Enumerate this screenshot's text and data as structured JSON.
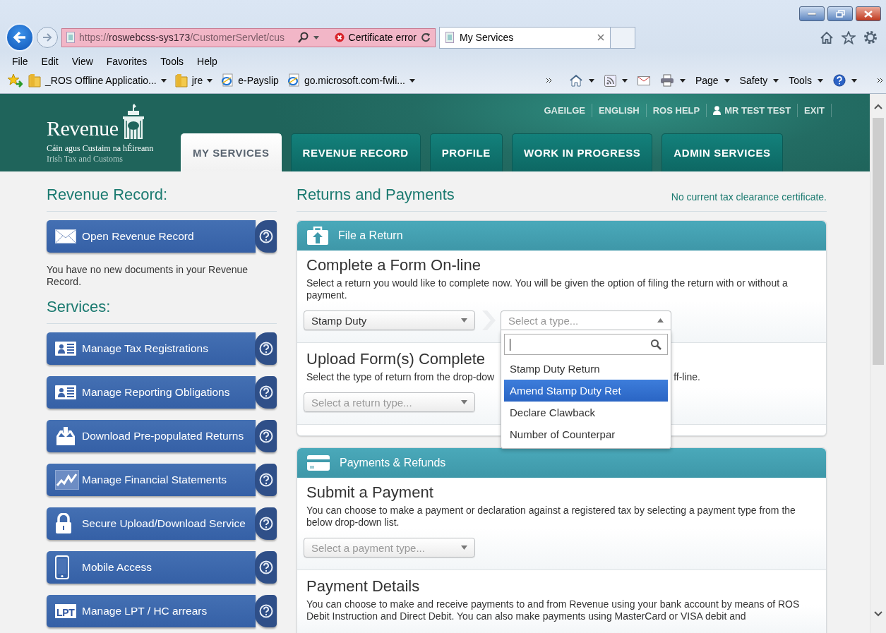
{
  "browser": {
    "address": {
      "scheme": "https://",
      "host": "roswebcss-sys173",
      "path": "/CustomerServlet/cus"
    },
    "certificate_error": "Certificate error",
    "tabs": [
      {
        "title": "My Services",
        "selected": true
      }
    ],
    "menu": [
      "File",
      "Edit",
      "View",
      "Favorites",
      "Tools",
      "Help"
    ],
    "favorites": [
      {
        "kind": "folder",
        "label": "_ROS Offline Applicatio...",
        "dropdown": true
      },
      {
        "kind": "folder",
        "label": "jre",
        "dropdown": true
      },
      {
        "kind": "page",
        "label": "e-Payslip",
        "dropdown": false
      },
      {
        "kind": "page",
        "label": "go.microsoft.com-fwli...",
        "dropdown": true
      }
    ],
    "commands": [
      {
        "kind": "home",
        "dropdown": true
      },
      {
        "kind": "feed",
        "dropdown": true
      },
      {
        "kind": "mail",
        "dropdown": false
      },
      {
        "kind": "print",
        "dropdown": true
      },
      {
        "kind": "text",
        "label": "Page",
        "dropdown": true
      },
      {
        "kind": "text",
        "label": "Safety",
        "dropdown": true
      },
      {
        "kind": "text",
        "label": "Tools",
        "dropdown": true
      },
      {
        "kind": "help",
        "dropdown": true
      }
    ]
  },
  "header": {
    "logo": {
      "name": "Revenue",
      "irish": "Cáin agus Custaim na hÉireann",
      "english": "Irish Tax and Customs"
    },
    "links": [
      {
        "kind": "link",
        "label": "GAEILGE"
      },
      {
        "kind": "link",
        "label": "ENGLISH"
      },
      {
        "kind": "link",
        "label": "ROS HELP"
      },
      {
        "kind": "user",
        "label": "MR TEST TEST"
      },
      {
        "kind": "link",
        "label": "EXIT"
      }
    ],
    "tabs": [
      {
        "label": "MY SERVICES",
        "selected": true
      },
      {
        "label": "REVENUE RECORD",
        "selected": false
      },
      {
        "label": "PROFILE",
        "selected": false
      },
      {
        "label": "WORK IN PROGRESS",
        "selected": false
      },
      {
        "label": "ADMIN SERVICES",
        "selected": false
      }
    ]
  },
  "sidebar": {
    "record_heading": "Revenue Record:",
    "record_button": {
      "kind": "envelope",
      "label": "Open Revenue Record"
    },
    "record_note": "You have no new documents in your Revenue Record.",
    "services_heading": "Services:",
    "services": [
      {
        "kind": "card",
        "label": "Manage Tax Registrations"
      },
      {
        "kind": "card",
        "label": "Manage Reporting Obligations"
      },
      {
        "kind": "download",
        "label": "Download Pre-populated Returns"
      },
      {
        "kind": "chart",
        "label": "Manage Financial Statements"
      },
      {
        "kind": "lock",
        "label": "Secure Upload/Download Service"
      },
      {
        "kind": "phone",
        "label": "Mobile Access"
      },
      {
        "kind": "badge",
        "badge": "LPT",
        "label": "Manage LPT / HC arrears"
      }
    ]
  },
  "main": {
    "heading": "Returns and Payments",
    "clearance": "No current tax clearance certificate.",
    "panels": [
      {
        "kind": "file",
        "title": "File a Return",
        "sections": [
          {
            "heading": "Complete a Form On-line",
            "text": "Select a return you would like to complete now. You will be given the option of filing the return with or without a payment.",
            "selects": [
              {
                "value": "Stamp Duty",
                "open": false
              },
              {
                "placeholder": "Select a type...",
                "open": true,
                "options": [
                  {
                    "label": "Stamp Duty Return",
                    "selected": false
                  },
                  {
                    "label": "Amend Stamp Duty Ret",
                    "selected": true
                  },
                  {
                    "label": "Declare Clawback",
                    "selected": false
                  },
                  {
                    "label": "Number of Counterpar",
                    "selected": false
                  }
                ]
              }
            ]
          },
          {
            "heading": "Upload Form(s) Complete",
            "text": "Select the type of return from the drop-dow",
            "text_after": "ff-line.",
            "selects": [
              {
                "placeholder": "Select a return type...",
                "open": false
              }
            ]
          }
        ]
      },
      {
        "kind": "payment",
        "title": "Payments & Refunds",
        "sections": [
          {
            "heading": "Submit a Payment",
            "text": "You can choose to make a payment or declaration against a registered tax by selecting a payment type from the below drop-down list.",
            "selects": [
              {
                "placeholder": "Select a payment type...",
                "open": false
              }
            ]
          },
          {
            "heading": "Payment Details",
            "text": "You can choose to make and receive payments to and from Revenue using your bank account by means of ROS Debit Instruction and Direct Debit. You can also make payments using MasterCard or VISA debit and"
          }
        ]
      }
    ]
  }
}
